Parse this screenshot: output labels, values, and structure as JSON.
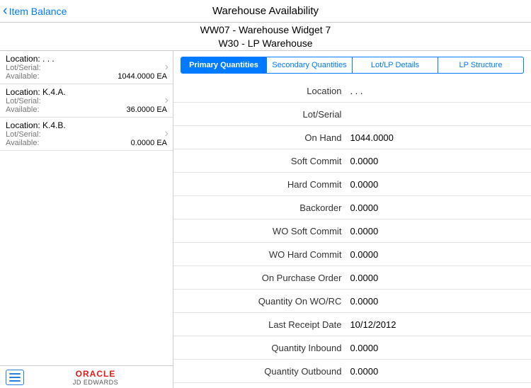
{
  "nav": {
    "back_label": "Item Balance",
    "title": "Warehouse Availability"
  },
  "subheader": {
    "line1": "WW07 - Warehouse Widget 7",
    "line2": "W30 - LP Warehouse"
  },
  "locations": [
    {
      "loc_label": "Location:  .  .  .",
      "lot_label": "Lot/Serial:",
      "avail_label": "Available:",
      "avail_value": "1044.0000 EA"
    },
    {
      "loc_label": "Location: K.4.A.",
      "lot_label": "Lot/Serial:",
      "avail_label": "Available:",
      "avail_value": "36.0000 EA"
    },
    {
      "loc_label": "Location: K.4.B.",
      "lot_label": "Lot/Serial:",
      "avail_label": "Available:",
      "avail_value": "0.0000 EA"
    }
  ],
  "tabs": [
    "Primary Quantities",
    "Secondary Quantities",
    "Lot/LP Details",
    "LP Structure"
  ],
  "details": [
    {
      "label": "Location",
      "value": ".  .  ."
    },
    {
      "label": "Lot/Serial",
      "value": ""
    },
    {
      "label": "On Hand",
      "value": "1044.0000"
    },
    {
      "label": "Soft Commit",
      "value": "0.0000"
    },
    {
      "label": "Hard Commit",
      "value": "0.0000"
    },
    {
      "label": "Backorder",
      "value": "0.0000"
    },
    {
      "label": "WO Soft Commit",
      "value": "0.0000"
    },
    {
      "label": "WO Hard Commit",
      "value": "0.0000"
    },
    {
      "label": "On Purchase Order",
      "value": "0.0000"
    },
    {
      "label": "Quantity On WO/RC",
      "value": "0.0000"
    },
    {
      "label": "Last Receipt Date",
      "value": "10/12/2012"
    },
    {
      "label": "Quantity Inbound",
      "value": "0.0000"
    },
    {
      "label": "Quantity Outbound",
      "value": "0.0000"
    }
  ],
  "branding": {
    "oracle": "ORACLE",
    "jde": "JD EDWARDS"
  }
}
